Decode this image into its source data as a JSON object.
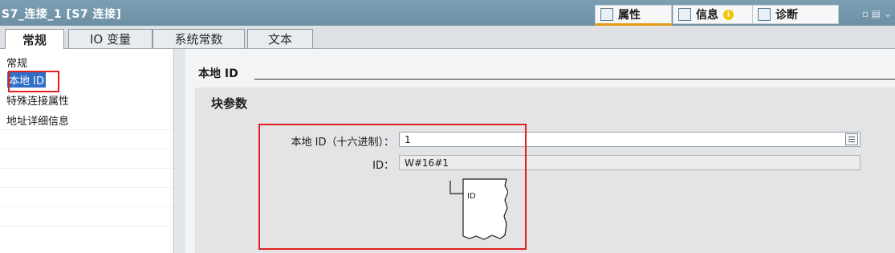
{
  "window": {
    "title": "S7_连接_1 [S7 连接]",
    "panels": [
      {
        "label": "属性",
        "icon": "properties-icon",
        "active": true
      },
      {
        "label": "信息",
        "icon": "info-icon",
        "badge": "i"
      },
      {
        "label": "诊断",
        "icon": "diagnostics-icon"
      }
    ]
  },
  "tabs": [
    {
      "label": "常规",
      "active": true
    },
    {
      "label": "IO 变量"
    },
    {
      "label": "系统常数"
    },
    {
      "label": "文本"
    }
  ],
  "sidebar": {
    "items": [
      {
        "label": "常规"
      },
      {
        "label": "本地 ID",
        "selected": true
      },
      {
        "label": "特殊连接属性"
      },
      {
        "label": "地址详细信息"
      }
    ]
  },
  "main": {
    "section_title": "本地 ID",
    "group_title": "块参数",
    "local_id_label": "本地 ID（十六进制）：",
    "local_id_value": "1",
    "id_label": "ID：",
    "id_value": "W#16#1",
    "block_pin_label": "ID"
  },
  "colors": {
    "highlight": "#e02020",
    "selection": "#2f6fc7",
    "titlebar": "#7293a8"
  }
}
